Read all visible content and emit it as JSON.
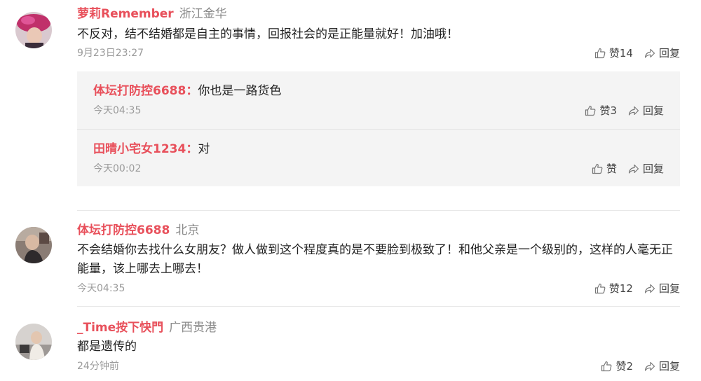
{
  "comments": [
    {
      "user": "萝莉Remember",
      "location": "浙江金华",
      "text": "不反对，结不结婚都是自主的事情，回报社会的是正能量就好！加油哦！",
      "time": "9月23日23:27",
      "like_label": "赞14",
      "reply_label": "回复",
      "replies": [
        {
          "user": "体坛打防控6688：",
          "text": "你也是一路货色",
          "time": "今天04:35",
          "like_label": "赞3",
          "reply_label": "回复"
        },
        {
          "user": "田晴小宅女1234：",
          "text": "对",
          "time": "今天00:02",
          "like_label": "赞",
          "reply_label": "回复"
        }
      ]
    },
    {
      "user": "体坛打防控6688",
      "location": "北京",
      "text": "不会结婚你去找什么女朋友？做人做到这个程度真的是不要脸到极致了！和他父亲是一个级别的，这样的人毫无正能量，该上哪去上哪去！",
      "time": "今天04:35",
      "like_label": "赞12",
      "reply_label": "回复"
    },
    {
      "user": "_Time按下快門",
      "location": "广西贵港",
      "text": "都是遗传的",
      "time": "24分钟前",
      "like_label": "赞2",
      "reply_label": "回复"
    }
  ],
  "icons": {
    "like": "thumbs-up-icon",
    "reply": "share-arrow-icon"
  },
  "colors": {
    "username": "#e8505b",
    "meta": "#9b9b9b",
    "reply_bg": "#f4f4f4"
  }
}
